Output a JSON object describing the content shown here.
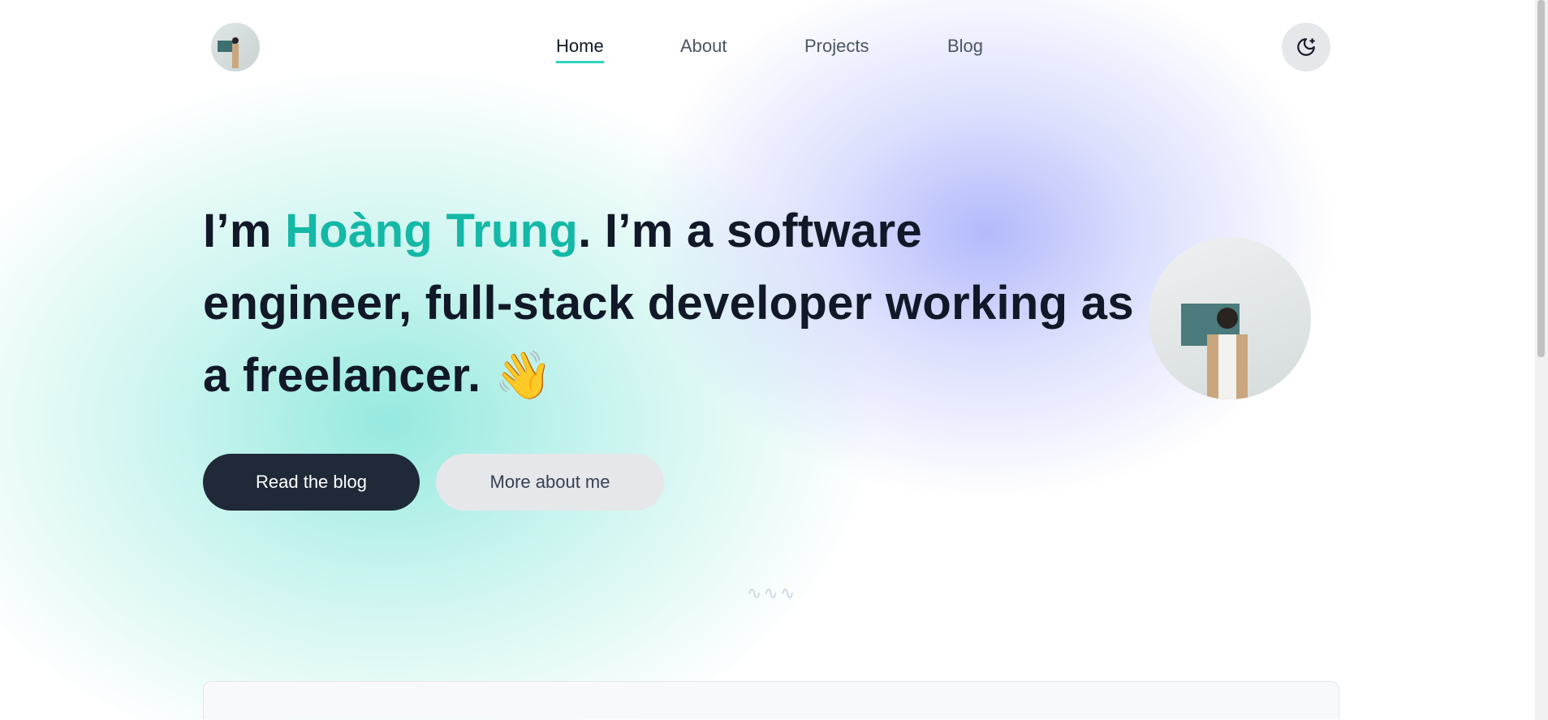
{
  "nav": {
    "items": [
      {
        "label": "Home",
        "active": true
      },
      {
        "label": "About",
        "active": false
      },
      {
        "label": "Projects",
        "active": false
      },
      {
        "label": "Blog",
        "active": false
      }
    ],
    "theme_toggle_icon": "moon-star-icon"
  },
  "hero": {
    "intro_prefix": "I’m ",
    "name": "Hoàng Trung",
    "intro_rest": ". I’m a software engineer, full-stack developer working as a freelancer. ",
    "emoji": "👋",
    "primary_button": "Read the blog",
    "secondary_button": "More about me",
    "divider": "∿∿∿"
  },
  "colors": {
    "accent": "#14b8a6",
    "dark": "#1f2937",
    "underline": "#2dd4bf"
  }
}
